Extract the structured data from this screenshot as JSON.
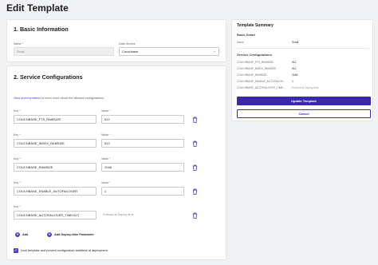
{
  "page": {
    "title": "Edit Template"
  },
  "basic": {
    "heading": "1. Basic Information",
    "name_label": "Name",
    "name_value": "Small",
    "data_service_label": "Data Service",
    "data_service_value": "Couchbase",
    "required_mark": "*"
  },
  "service": {
    "heading": "2. Service Configurations",
    "intro_link": "View documentation",
    "intro_text": " to learn more about the allowed configurations.",
    "key_label": "Key",
    "value_label": "Value",
    "rows": [
      {
        "key": "COUCHBASE_FTS_RAMSIZE",
        "value": "512"
      },
      {
        "key": "COUCHBASE_INDEX_RAMSIZE",
        "value": "512"
      },
      {
        "key": "COUCHBASE_RAMSIZE",
        "value": "2048"
      },
      {
        "key": "COUCHBASE_ENABLE_AUTOFAILOVER",
        "value": "1"
      },
      {
        "key": "COUCHBASE_AUTOFAILOVER_TIMEOUT",
        "value": "Entered at Deploy time"
      }
    ],
    "add_label": "Add",
    "add_deploy_label": "Add Deploy-time Parameter",
    "lock_label": "Lock template and prevent configuration additions at deployment."
  },
  "summary": {
    "title": "Template Summary",
    "basic_heading": "Basic Detail",
    "name_key": "Name",
    "name_value": "Small",
    "config_heading": "Service Configurations",
    "items": [
      {
        "k": "COUCHBASE_FTS_RAMSIZE",
        "v": "512"
      },
      {
        "k": "COUCHBASE_INDEX_RAMSIZE",
        "v": "512"
      },
      {
        "k": "COUCHBASE_RAMSIZE",
        "v": "2048"
      },
      {
        "k": "COUCHBASE_ENABLE_AUTOFAILOV...",
        "v": "1"
      },
      {
        "k": "COUCHBASE_AUTOFAILOVER_TIME...",
        "v": "Entered at Deploy time"
      }
    ],
    "update_button": "Update Template",
    "cancel_button": "Cancel"
  },
  "colors": {
    "accent": "#3b2aa8",
    "link": "#4b3ed1",
    "required": "#d0334e"
  },
  "icons": {
    "delete": "trash-icon",
    "add": "plus-circle-icon",
    "select": "chevron-down-icon",
    "lock": "checkbox-checked-icon"
  }
}
